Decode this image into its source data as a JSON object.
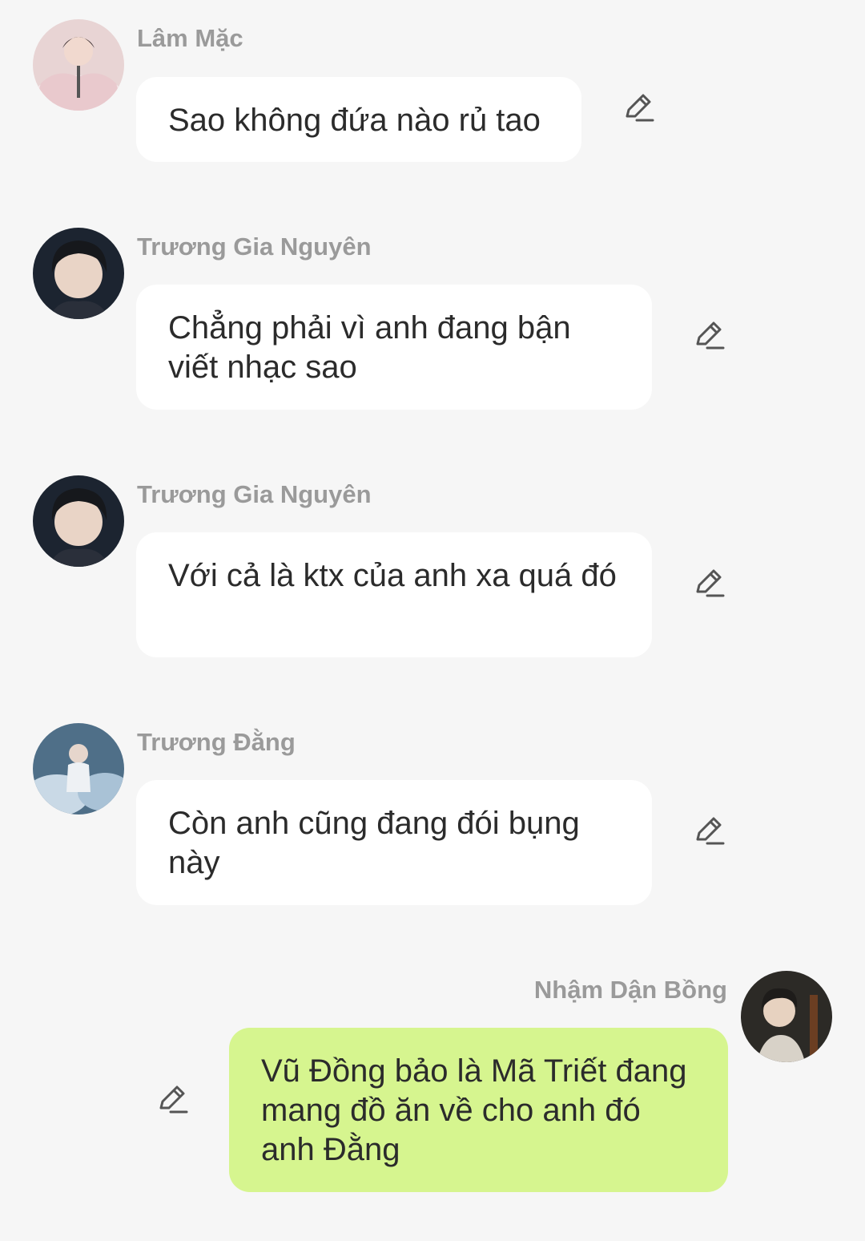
{
  "messages": [
    {
      "sender": "Lâm Mặc",
      "text": "Sao không đứa nào rủ tao",
      "avatar_icon": "avatar-photo-icon",
      "edit_icon": "pencil-icon"
    },
    {
      "sender": "Trương Gia Nguyên",
      "text": "Chẳng phải vì anh đang bận viết nhạc sao",
      "avatar_icon": "avatar-photo-icon",
      "edit_icon": "pencil-icon"
    },
    {
      "sender": "Trương Gia Nguyên",
      "text": "Với cả là ktx của anh xa quá đó",
      "avatar_icon": "avatar-photo-icon",
      "edit_icon": "pencil-icon"
    },
    {
      "sender": "Trương Đằng",
      "text": "Còn anh cũng đang đói bụng này",
      "avatar_icon": "avatar-photo-icon",
      "edit_icon": "pencil-icon"
    },
    {
      "sender": "Nhậm Dận Bồng",
      "text": "Vũ Đồng bảo là Mã Triết đang mang đồ ăn về cho anh đó anh Đằng",
      "avatar_icon": "avatar-photo-icon",
      "edit_icon": "pencil-icon"
    }
  ],
  "colors": {
    "background": "#f6f6f6",
    "incoming_bubble": "#ffffff",
    "outgoing_bubble": "#d6f58f",
    "sender_name": "#9a9a9a",
    "message_text": "#2b2b2b",
    "icon": "#555555"
  }
}
